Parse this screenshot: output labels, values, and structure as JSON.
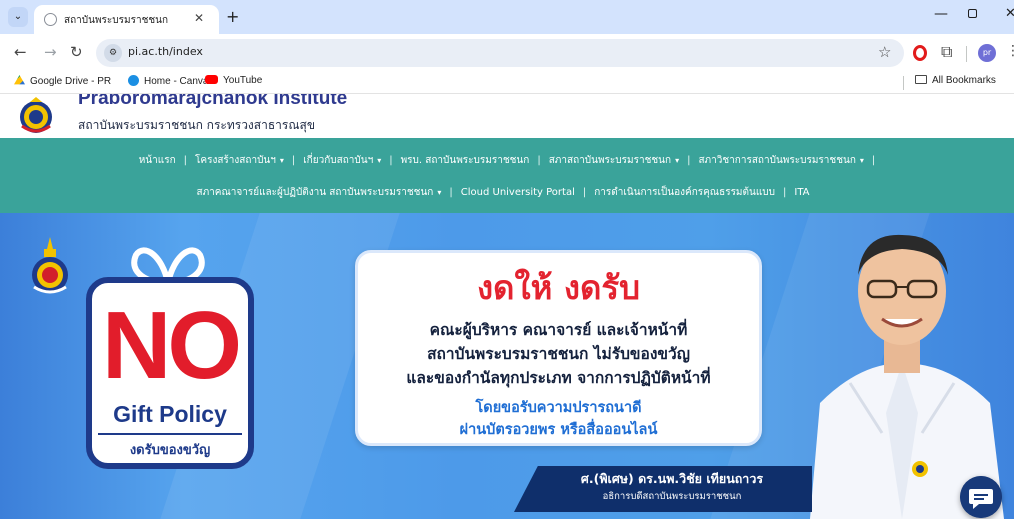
{
  "browser": {
    "tab": {
      "title": "สถาบันพระบรมราชชนก",
      "favicon": "globe-icon"
    },
    "url": "pi.ac.th/index",
    "profile_initials": "pr",
    "bookmarks": [
      {
        "label": "Google Drive - PR",
        "icon": "google-drive-icon"
      },
      {
        "label": "Home - Canva",
        "icon": "canva-icon"
      },
      {
        "label": "YouTube",
        "icon": "youtube-icon"
      }
    ],
    "all_bookmarks_label": "All Bookmarks"
  },
  "site": {
    "name_en": "Praboromarajchanok Institute",
    "name_th": "สถาบันพระบรมราชชนก กระทรวงสาธารณสุข",
    "nav_row1": [
      {
        "label": "หน้าแรก",
        "dropdown": false
      },
      {
        "label": "โครงสร้างสถาบันฯ",
        "dropdown": true
      },
      {
        "label": "เกี่ยวกับสถาบันฯ",
        "dropdown": true
      },
      {
        "label": "พรบ. สถาบันพระบรมราชชนก",
        "dropdown": false
      },
      {
        "label": "สภาสถาบันพระบรมราชชนก",
        "dropdown": true
      },
      {
        "label": "สภาวิชาการสถาบันพระบรมราชชนก",
        "dropdown": true
      }
    ],
    "nav_row2": [
      {
        "label": "สภาคณาจารย์และผู้ปฏิบัติงาน สถาบันพระบรมราชชนก",
        "dropdown": true
      },
      {
        "label": "Cloud University Portal",
        "dropdown": false
      },
      {
        "label": "การดำเนินการเป็นองค์กรคุณธรรมต้นแบบ",
        "dropdown": false
      },
      {
        "label": "ITA",
        "dropdown": false
      }
    ]
  },
  "hero": {
    "no": "NO",
    "gift_policy": "Gift Policy",
    "gift_sub": "งดรับของขวัญ",
    "title": "งดให้ งดรับ",
    "lines": [
      "คณะผู้บริหาร คณาจารย์ และเจ้าหน้าที่",
      "สถาบันพระบรมราชชนก ไม่รับของขวัญ",
      "และของกำนัลทุกประเภท จากการปฏิบัติหน้าที่"
    ],
    "blue_lines": [
      "โดยขอรับความปรารถนาดี",
      "ผ่านบัตรอวยพร หรือสื่อออนไลน์"
    ],
    "person_name": "ศ.(พิเศษ) ดร.นพ.วิชัย เทียนถาวร",
    "person_title": "อธิการบดีสถาบันพระบรมราชชนก"
  },
  "colors": {
    "teal_nav": "#3aa39a",
    "hero_blue": "#4f9fe9",
    "red": "#e3232f",
    "navy": "#1e3a8a"
  }
}
